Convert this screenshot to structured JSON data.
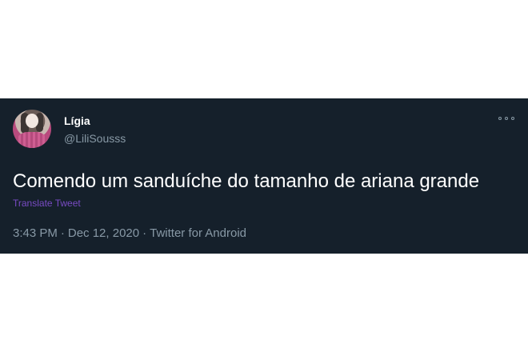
{
  "tweet": {
    "author": {
      "display_name": "Lígia",
      "handle": "@LiliSousss"
    },
    "text": "Comendo um sanduíche do tamanho de ariana grande",
    "translate_label": "Translate Tweet",
    "time": "3:43 PM",
    "date": "Dec 12, 2020",
    "source": "Twitter for Android",
    "separator": "·"
  },
  "icons": {
    "more": "more-options-icon",
    "avatar": "avatar"
  },
  "colors": {
    "card_background": "#15202b",
    "primary_text": "#ffffff",
    "secondary_text": "#8899a6",
    "translate_link": "#794bc4"
  }
}
